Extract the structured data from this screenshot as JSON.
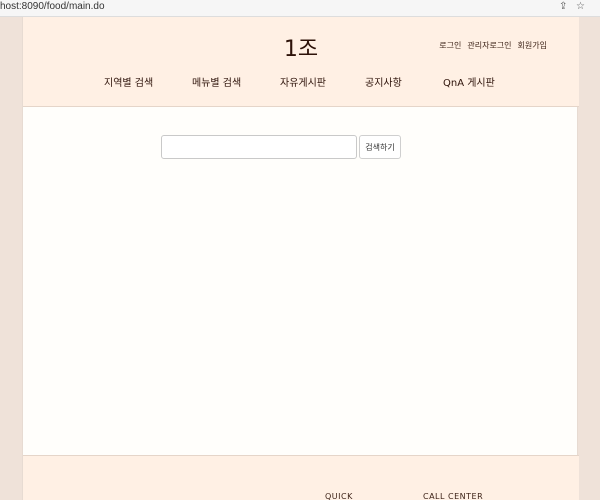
{
  "browser": {
    "url": "host:8090/food/main.do",
    "share_icon": "share-icon",
    "bookmark_icon": "star-icon"
  },
  "header": {
    "logo": "1조",
    "user_links": [
      "로그인",
      "관리자로그인",
      "회원가입"
    ],
    "nav": [
      "지역별 검색",
      "메뉴별 검색",
      "자유게시판",
      "공지사항",
      "QnA 게시판"
    ]
  },
  "search": {
    "placeholder": "",
    "button_label": "검색하기"
  },
  "footer": {
    "quick_label": "QUICK",
    "call_center_label": "CALL CENTER"
  },
  "colors": {
    "outer_bg": "#efe2d9",
    "header_bg": "#fff0e4",
    "content_bg": "#fffefb"
  }
}
